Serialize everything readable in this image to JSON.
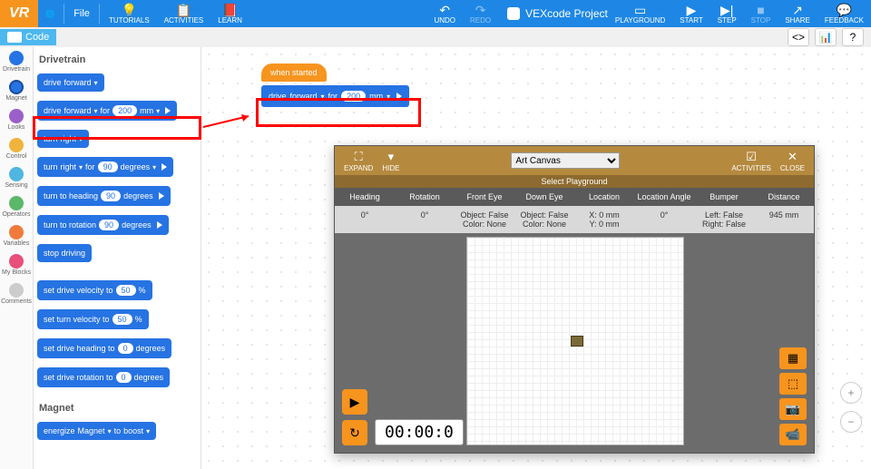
{
  "top": {
    "logo": "VR",
    "globe": "🌐",
    "file": "File",
    "tutorials": "TUTORIALS",
    "activities": "ACTIVITIES",
    "learn": "LEARN",
    "undo": "UNDO",
    "redo": "REDO",
    "project": "VEXcode Project",
    "playground": "PLAYGROUND",
    "start": "START",
    "step": "STEP",
    "stop": "STOP",
    "share": "SHARE",
    "feedback": "FEEDBACK"
  },
  "codebar": {
    "code": "Code"
  },
  "cats": {
    "drivetrain": "Drivetrain",
    "magnet": "Magnet",
    "looks": "Looks",
    "control": "Control",
    "sensing": "Sensing",
    "operators": "Operators",
    "variables": "Variables",
    "myblocks": "My Blocks",
    "comments": "Comments"
  },
  "pal": {
    "head_drivetrain": "Drivetrain",
    "drive": "drive",
    "forward": "forward",
    "for": "for",
    "v200": "200",
    "mm": "mm",
    "turn": "turn",
    "right": "right",
    "v90": "90",
    "degrees": "degrees",
    "turn_to_heading": "turn to heading",
    "turn_to_rotation": "turn to rotation",
    "stop_driving": "stop driving",
    "set_drive_velocity": "set drive velocity to",
    "v50": "50",
    "pct": "%",
    "set_turn_velocity": "set turn velocity to",
    "set_drive_heading": "set drive heading to",
    "v0": "0",
    "set_drive_rotation": "set drive rotation to",
    "head_magnet": "Magnet",
    "energize": "energize",
    "magnet": "Magnet",
    "to": "to",
    "boost": "boost"
  },
  "canvas": {
    "when_started": "when started"
  },
  "pg": {
    "expand": "EXPAND",
    "hide": "HIDE",
    "sel": "Art Canvas",
    "activities": "ACTIVITIES",
    "close": "CLOSE",
    "subtitle": "Select Playground",
    "th": {
      "heading": "Heading",
      "rotation": "Rotation",
      "fronteye": "Front Eye",
      "downeye": "Down Eye",
      "location": "Location",
      "locangle": "Location Angle",
      "bumper": "Bumper",
      "distance": "Distance"
    },
    "td": {
      "heading": "0°",
      "rotation": "0°",
      "fronteye": "Object: False\nColor: None",
      "downeye": "Object: False\nColor: None",
      "location": "X: 0 mm\nY: 0 mm",
      "locangle": "0°",
      "bumper": "Left: False\nRight: False",
      "distance": "945 mm"
    },
    "timer": "00:00:0"
  }
}
